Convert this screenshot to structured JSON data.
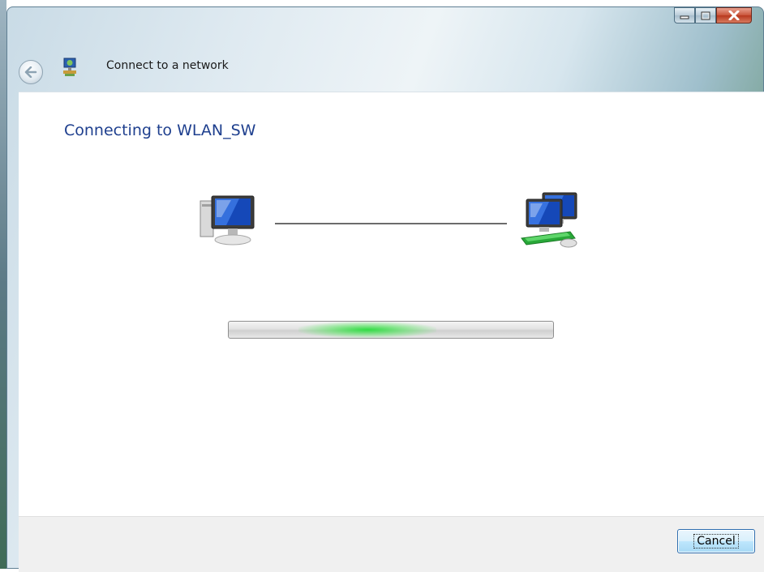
{
  "window": {
    "title": "Connect to a network",
    "caption_buttons": [
      "minimize-icon",
      "maximize-icon",
      "close-icon"
    ]
  },
  "main": {
    "heading": "Connecting to WLAN_SW",
    "progress": {
      "state": "indeterminate",
      "color": "#28dc3c"
    },
    "icons": {
      "left": "computer-icon",
      "right": "network-icon"
    }
  },
  "footer": {
    "cancel_label": "Cancel"
  },
  "colors": {
    "heading": "#1e3f8e",
    "accent": "#2f6fb0"
  }
}
